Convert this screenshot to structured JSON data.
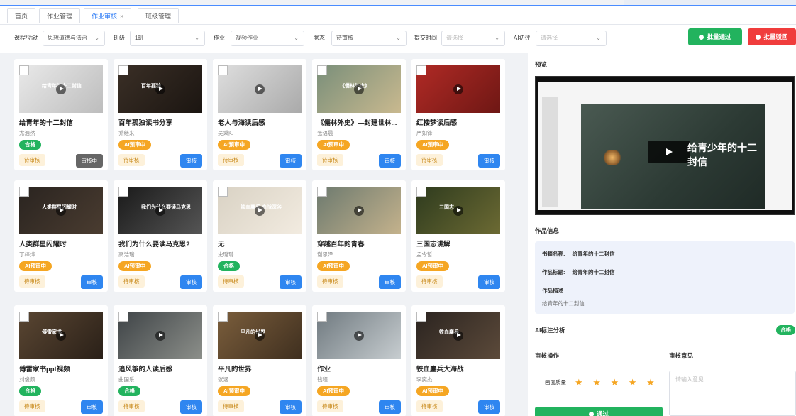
{
  "tabs": [
    {
      "label": "首页"
    },
    {
      "label": "作业管理"
    },
    {
      "label": "作业审核",
      "close": "×"
    },
    {
      "label": "班级管理"
    }
  ],
  "filters": {
    "course_label": "课程/活动",
    "course_value": "思想道德与法治",
    "class_label": "班级",
    "class_value": "1班",
    "homework_label": "作业",
    "homework_value": "视频作业",
    "status_label": "状态",
    "status_value": "待审核",
    "submit_time_label": "提交时间",
    "submit_time_placeholder": "请选择",
    "ai_label": "AI初评",
    "ai_placeholder": "请选择"
  },
  "actions": {
    "batch_pass": "批量通过",
    "batch_reject": "批量驳回"
  },
  "cards": [
    {
      "title": "给青年的十二封信",
      "author": "尤浩然",
      "badge": "合格",
      "badge_type": "ok",
      "pending": "待审核",
      "button": "审核中",
      "button_type": "gray",
      "thumb_text": "给青年的十二封信"
    },
    {
      "title": "百年孤独读书分享",
      "author": "乔继来",
      "badge": "AI预审中",
      "badge_type": "ai",
      "pending": "待审核",
      "button": "审核",
      "button_type": "blue",
      "thumb_text": "百年孤独"
    },
    {
      "title": "老人与海读后感",
      "author": "吴秉阳",
      "badge": "AI预审中",
      "badge_type": "ai",
      "pending": "待审核",
      "button": "审核",
      "button_type": "blue",
      "thumb_text": ""
    },
    {
      "title": "《儒林外史》—封建世林...",
      "author": "张语晨",
      "badge": "AI预审中",
      "badge_type": "ai",
      "pending": "待审核",
      "button": "审核",
      "button_type": "blue",
      "thumb_text": "《儒林外史》"
    },
    {
      "title": "红楼梦读后感",
      "author": "严如锋",
      "badge": "AI预审中",
      "badge_type": "ai",
      "pending": "待审核",
      "button": "审核",
      "button_type": "blue",
      "thumb_text": ""
    },
    {
      "title": "人类群星闪耀时",
      "author": "丁梓烨",
      "badge": "AI预审中",
      "badge_type": "ai",
      "pending": "待审核",
      "button": "审核",
      "button_type": "blue",
      "thumb_text": "人类群星闪耀时"
    },
    {
      "title": "我们为什么要读马克思?",
      "author": "高浩瑞",
      "badge": "AI预审中",
      "badge_type": "ai",
      "pending": "待审核",
      "button": "审核",
      "button_type": "blue",
      "thumb_text": "我们为什么要读马克思"
    },
    {
      "title": "无",
      "author": "史璐璐",
      "badge": "合格",
      "badge_type": "ok",
      "pending": "待审核",
      "button": "审核",
      "button_type": "blue",
      "thumb_text": "铁血鏖兵 血战深谷"
    },
    {
      "title": "穿越百年的青春",
      "author": "谢思泽",
      "badge": "AI预审中",
      "badge_type": "ai",
      "pending": "待审核",
      "button": "审核",
      "button_type": "blue",
      "thumb_text": ""
    },
    {
      "title": "三国志讲解",
      "author": "孟令哲",
      "badge": "AI预审中",
      "badge_type": "ai",
      "pending": "待审核",
      "button": "审核",
      "button_type": "blue",
      "thumb_text": "三国志"
    },
    {
      "title": "傅雷家书ppt视频",
      "author": "刘俊颜",
      "badge": "合格",
      "badge_type": "ok",
      "pending": "待审核",
      "button": "审核",
      "button_type": "blue",
      "thumb_text": "傅雷家书"
    },
    {
      "title": "追风筝的人读后感",
      "author": "曲国乐",
      "badge": "合格",
      "badge_type": "ok",
      "pending": "待审核",
      "button": "审核",
      "button_type": "blue",
      "thumb_text": ""
    },
    {
      "title": "平凡的世界",
      "author": "张涵",
      "badge": "AI预审中",
      "badge_type": "ai",
      "pending": "待审核",
      "button": "审核",
      "button_type": "blue",
      "thumb_text": "平凡的世界"
    },
    {
      "title": "作业",
      "author": "钱程",
      "badge": "AI预审中",
      "badge_type": "ai",
      "pending": "待审核",
      "button": "审核",
      "button_type": "blue",
      "thumb_text": ""
    },
    {
      "title": "铁血鏖兵大海战",
      "author": "李奕杰",
      "badge": "AI预审中",
      "badge_type": "ai",
      "pending": "待审核",
      "button": "审核",
      "button_type": "blue",
      "thumb_text": "铁血鏖兵"
    }
  ],
  "detail": {
    "preview_label": "预览",
    "video_title": "给青少年的十二封信",
    "info_label": "作品信息",
    "book_name_label": "书籍名称:",
    "book_name": "给青年的十二封信",
    "work_title_label": "作品标题:",
    "work_title": "给青年的十二封信",
    "desc_label": "作品描述:",
    "desc": "给青年的十二封信",
    "ai_label": "AI标注分析",
    "ai_result": "合格",
    "review_label": "审核操作",
    "opinion_label": "审核意见",
    "quality_label": "画面质量",
    "stars": "★ ★ ★ ★ ★",
    "opinion_placeholder": "请输入意见",
    "pass_button": "通过"
  },
  "colors": {
    "primary": "#2f86f0",
    "success": "#22b35e",
    "danger": "#f03c3c",
    "warning": "#f5a623"
  }
}
